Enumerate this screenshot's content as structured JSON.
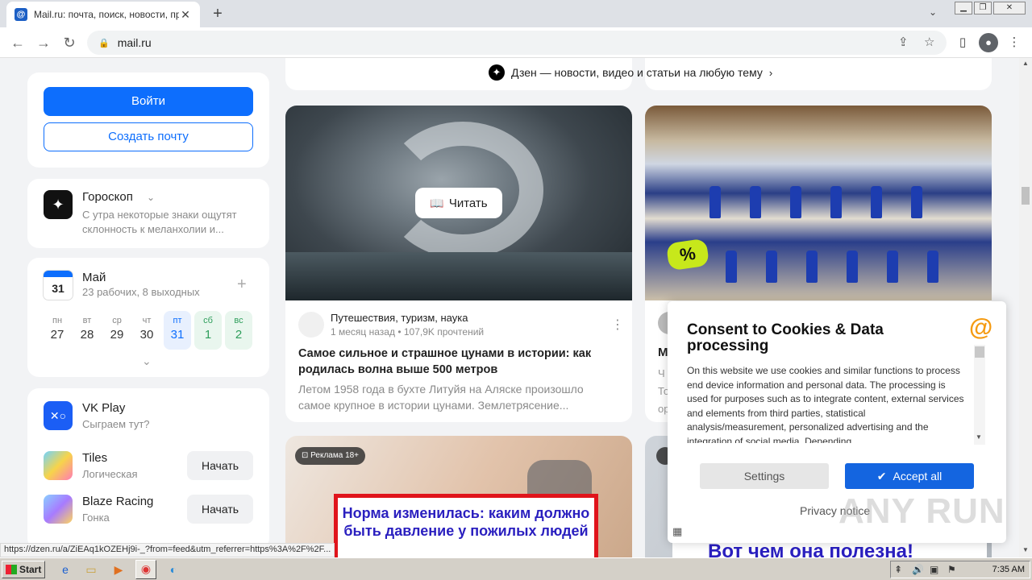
{
  "browser": {
    "tab_title": "Mail.ru: почта, поиск, новости, пр",
    "tab_favicon": "@",
    "url": "mail.ru",
    "newtab_icon": "+",
    "close_icon": "✕"
  },
  "sidebar": {
    "login_label": "Войти",
    "create_mail_label": "Создать почту",
    "horoscope": {
      "title": "Гороскоп",
      "text": "С утра некоторые знаки ощутят склонность к меланхолии и..."
    },
    "calendar": {
      "date_icon_num": "31",
      "month": "Май",
      "summary": "23 рабочих, 8 выходных",
      "add_icon": "+",
      "days": [
        {
          "d": "пн",
          "n": "27"
        },
        {
          "d": "вт",
          "n": "28"
        },
        {
          "d": "ср",
          "n": "29"
        },
        {
          "d": "чт",
          "n": "30"
        },
        {
          "d": "пт",
          "n": "31"
        },
        {
          "d": "сб",
          "n": "1"
        },
        {
          "d": "вс",
          "n": "2"
        }
      ]
    },
    "games": {
      "vkplay_title": "VK Play",
      "vkplay_sub": "Сыграем тут?",
      "items": [
        {
          "title": "Tiles",
          "sub": "Логическая",
          "btn": "Начать"
        },
        {
          "title": "Blaze Racing",
          "sub": "Гонка",
          "btn": "Начать"
        }
      ]
    }
  },
  "feed": {
    "dzen_label": "Дзен — новости, видео и статьи на любую тему",
    "article1": {
      "read_label": "Читать",
      "source": "Путешествия, туризм, наука",
      "meta": "1 месяц назад • 107,9K прочтений",
      "title": "Самое сильное и страшное цунами в истории: как родилась волна выше 500 метров",
      "desc": "Летом 1958 года в бухте Литуйя на Аляске произошло самое крупное в истории цунами. Землетрясение..."
    },
    "article2": {
      "badge": "%",
      "title_partial": "М",
      "desc_partial": "Ч То ор"
    },
    "ad1": {
      "badge": "Реклама 18+",
      "text": "Норма изменилась: каким должно быть давление у пожилых людей"
    },
    "ad2": {
      "text": "Вот чем она полезна!"
    }
  },
  "consent": {
    "title": "Consent to Cookies & Data processing",
    "text": "On this website we use cookies and similar functions to process end device information and personal data. The processing is used for purposes such as to integrate content, external services and elements from third parties, statistical analysis/measurement, personalized advertising and the integration of social media. Depending",
    "settings_label": "Settings",
    "accept_label": "Accept all",
    "privacy_label": "Privacy notice"
  },
  "status_url": "https://dzen.ru/a/ZiEAq1kOZEHj9i-_?from=feed&utm_referrer=https%3A%2F%2F...",
  "watermark": "ANY RUN",
  "taskbar": {
    "start_label": "Start",
    "clock": "7:35 AM"
  },
  "colors": {
    "accent": "#0d6efd",
    "consent_accept": "#1465e0",
    "mailru_orange": "#f59b12"
  }
}
